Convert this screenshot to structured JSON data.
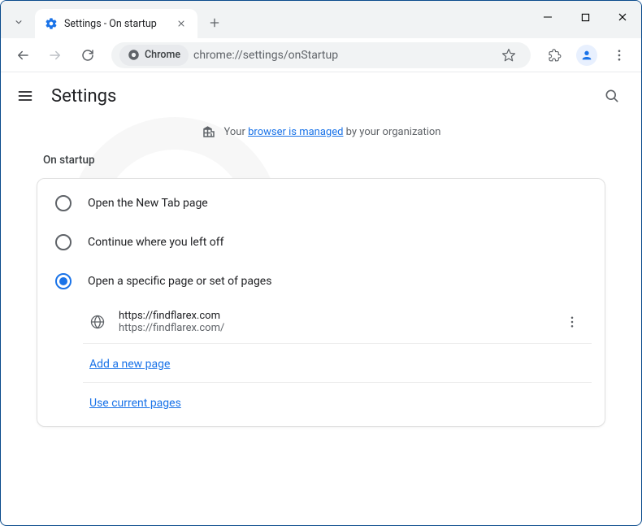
{
  "tab": {
    "title": "Settings - On startup"
  },
  "omnibox": {
    "chip": "Chrome",
    "url": "chrome://settings/onStartup"
  },
  "header": {
    "title": "Settings"
  },
  "managed": {
    "prefix": "Your ",
    "link": "browser is managed",
    "suffix": " by your organization"
  },
  "section": {
    "title": "On startup"
  },
  "options": [
    {
      "label": "Open the New Tab page"
    },
    {
      "label": "Continue where you left off"
    },
    {
      "label": "Open a specific page or set of pages"
    }
  ],
  "startup_page": {
    "title": "https://findflarex.com",
    "url": "https://findflarex.com/"
  },
  "links": {
    "add": "Add a new page",
    "current": "Use current pages"
  }
}
